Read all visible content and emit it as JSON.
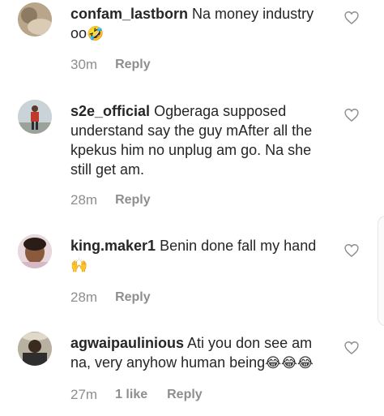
{
  "comments": [
    {
      "username": "confam_lastborn",
      "text": "Na money industry oo",
      "emoji": "🤣",
      "time": "30m",
      "likes": "",
      "reply_label": "Reply",
      "avatar_icon": "user-avatar"
    },
    {
      "username": "s2e_official",
      "text": "Ogberaga supposed understand say the guy mAfter all the kpekus him no unplug am go. Na she still get am.",
      "emoji": "",
      "time": "28m",
      "likes": "",
      "reply_label": "Reply",
      "avatar_icon": "user-avatar"
    },
    {
      "username": "king.maker1",
      "text": "Benin done fall my hand",
      "emoji": "🙌",
      "time": "28m",
      "likes": "",
      "reply_label": "Reply",
      "avatar_icon": "user-avatar"
    },
    {
      "username": "agwaipaulinious",
      "text": "Ati you don see am na, very anyhow human being",
      "emoji": "😂😂😂",
      "time": "27m",
      "likes": "1 like",
      "reply_label": "Reply",
      "avatar_icon": "user-avatar"
    }
  ],
  "like_icon": "heart-outline-icon",
  "colors": {
    "text": "#262626",
    "secondary": "#8e8e8e",
    "background": "#ffffff"
  }
}
